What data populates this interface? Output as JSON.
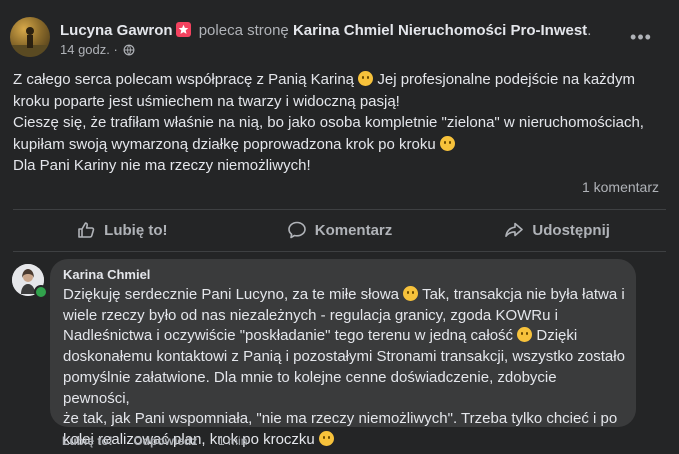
{
  "post": {
    "author": "Lucyna Gawron",
    "action": "poleca stronę",
    "page": "Karina Chmiel Nieruchomości Pro-Inwest",
    "period": ".",
    "time": "14 godz. ·",
    "more": "•••",
    "body_parts": [
      "Z całego serca polecam współpracę z Panią Kariną ",
      " Jej profesjonalne podejście na każdym\nkroku poparte jest uśmiechem na twarzy i widoczną pasją!\nCieszę się, że trafiłam właśnie na nią, bo jako osoba kompletnie \"zielona\" w nieruchomościach,\nkupiłam swoją wymarzoną działkę poprowadzona krok po kroku ",
      "\nDla Pani Kariny nie ma rzeczy niemożliwych!"
    ],
    "comments_count": "1 komentarz"
  },
  "actions": {
    "like": "Lubię to!",
    "comment": "Komentarz",
    "share": "Udostępnij"
  },
  "comment": {
    "author": "Karina Chmiel",
    "text_parts": [
      "Dziękuję serdecznie Pani Lucyno, za te miłe słowa ",
      " Tak, transakcja nie była łatwa i\nwiele rzeczy było od nas niezależnych - regulacja granicy, zgoda KOWRu i\nNadleśnictwa i oczywiście \"poskładanie\" tego terenu w jedną całość ",
      " Dzięki\ndoskonałemu kontaktowi z Panią i pozostałymi Stronami transakcji, wszystko zostało\npomyślnie załatwione. Dla mnie to kolejne cenne doświadczenie, zdobycie pewności,\nże tak, jak Pani wspomniała, \"nie ma rzeczy niemożliwych\". Trzeba tylko chcieć i po\nkolei realizować plan, krok po kroczku "
    ],
    "like": "Lubię to!",
    "reply": "Odpowiedz",
    "time": "1 min"
  },
  "colors": {
    "background": "#242526",
    "bubble": "#3a3b3c",
    "text": "#e4e6eb",
    "muted": "#b0b3b8",
    "badge": "#f3425f",
    "online": "#31a24c"
  },
  "icons": {
    "badge": "star-badge-icon",
    "privacy": "globe-icon",
    "like": "thumbs-up-icon",
    "comment": "speech-bubble-icon",
    "share": "share-arrow-icon"
  }
}
